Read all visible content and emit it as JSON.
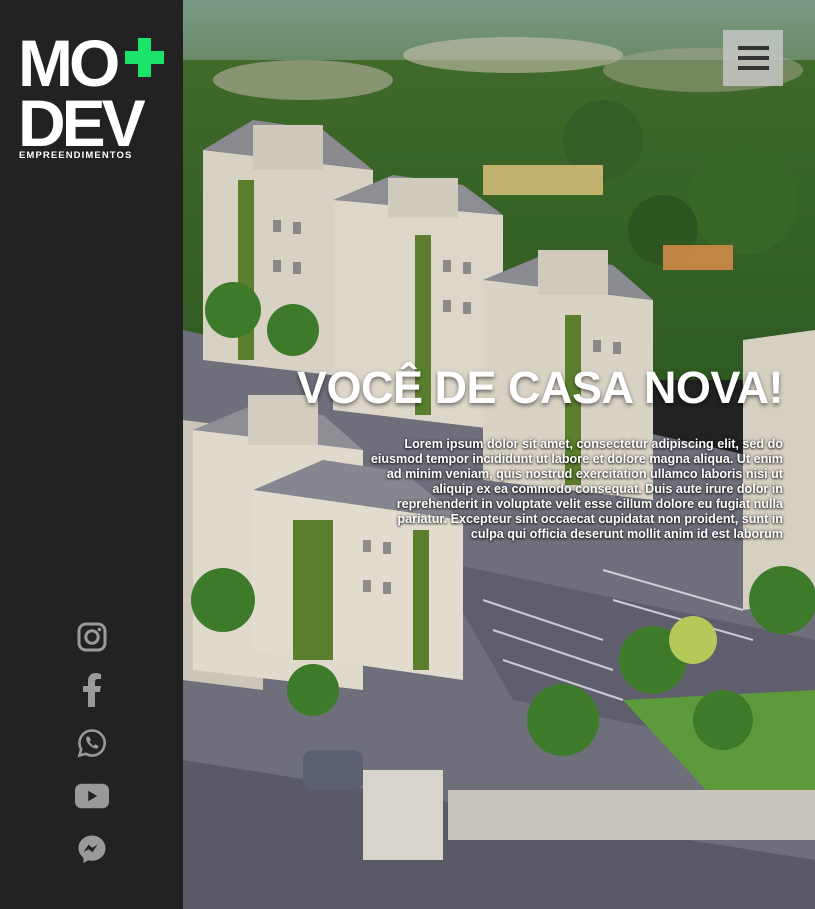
{
  "brand": {
    "logo_line1": "MO",
    "logo_line2": "DEV",
    "logo_tagline": "EMPREENDIMENTOS",
    "accent_color": "#1be36a"
  },
  "social": [
    {
      "icon": "instagram-icon"
    },
    {
      "icon": "facebook-icon"
    },
    {
      "icon": "whatsapp-icon"
    },
    {
      "icon": "youtube-icon"
    },
    {
      "icon": "messenger-icon"
    }
  ],
  "hero": {
    "title": "VOCÊ DE CASA NOVA!",
    "text": "Lorem ipsum dolor sit amet, consectetur adipiscing elit, sed do eiusmod tempor incididunt ut labore et dolore magna aliqua. Ut enim ad minim veniam, quis nostrud exercitation ullamco laboris nisi ut aliquip ex ea commodo consequat. Duis aute irure dolor in reprehenderit in voluptate velit esse cillum dolore eu fugiat nulla pariatur. Excepteur sint occaecat cupidatat non proident, sunt in culpa qui officia deserunt mollit anim id est laborum"
  },
  "menu": {
    "icon": "hamburger-menu-icon"
  }
}
